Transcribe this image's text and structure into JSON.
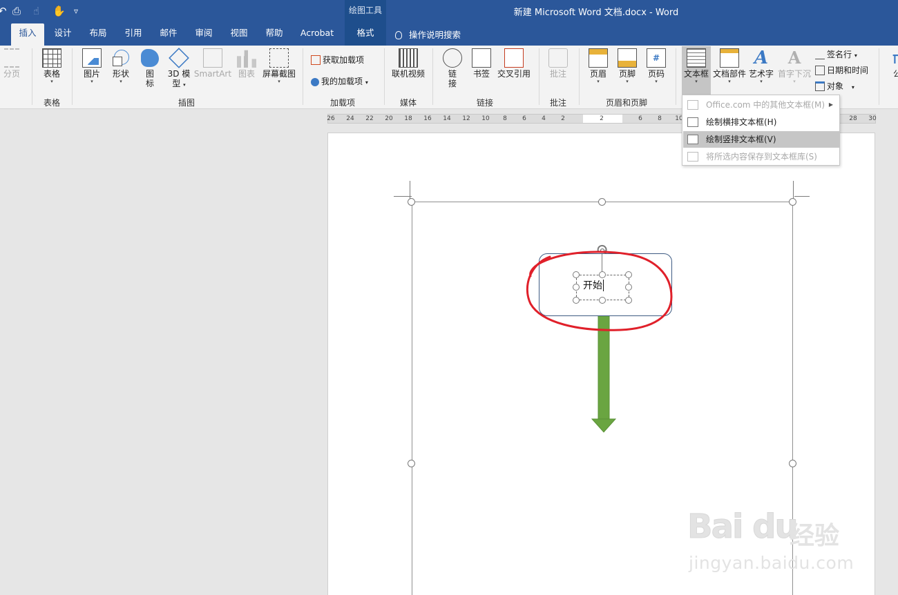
{
  "titlebar": {
    "doc_title": "新建 Microsoft Word 文档.docx  -  Word",
    "context_group": "绘图工具",
    "quick_access": {
      "undo": "↶",
      "print_preview": "⎙",
      "touch": "☝",
      "customize": "▿"
    }
  },
  "tabs": [
    {
      "label": "插入"
    },
    {
      "label": "设计"
    },
    {
      "label": "布局"
    },
    {
      "label": "引用"
    },
    {
      "label": "邮件"
    },
    {
      "label": "审阅"
    },
    {
      "label": "视图"
    },
    {
      "label": "帮助"
    },
    {
      "label": "Acrobat"
    },
    {
      "label": "格式"
    }
  ],
  "tell_me": "操作说明搜索",
  "ribbon": {
    "page_break": "分页",
    "table": "表格",
    "pictures": "图片",
    "shapes": "形状",
    "icons_line1": "图",
    "icons_line2": "标",
    "model3d_line1": "3D 模",
    "model3d_line2": "型",
    "smartart": "SmartArt",
    "chart": "图表",
    "screenshot": "屏幕截图",
    "get_addins": "获取加载项",
    "my_addins": "我的加载项",
    "online_video": "联机视频",
    "link_line1": "链",
    "link_line2": "接",
    "bookmark": "书签",
    "cross_ref": "交叉引用",
    "comment": "批注",
    "header": "页眉",
    "footer": "页脚",
    "page_number": "页码",
    "text_box": "文本框",
    "quick_parts": "文档部件",
    "wordart": "艺术字",
    "drop_cap": "首字下沉",
    "signature_line": "签名行",
    "date_time": "日期和时间",
    "object": "对象",
    "equation_partial": "公",
    "groups": {
      "tables": "表格",
      "illustrations": "插图",
      "addins": "加载项",
      "media": "媒体",
      "links": "链接",
      "comments": "批注",
      "header_footer": "页眉和页脚"
    }
  },
  "ruler_ticks": [
    "26",
    "24",
    "22",
    "20",
    "18",
    "16",
    "14",
    "12",
    "10",
    "8",
    "6",
    "4",
    "2",
    "2",
    "6",
    "8",
    "10",
    "28",
    "30"
  ],
  "textbox_menu": {
    "items": [
      {
        "label": "Office.com 中的其他文本框(M)",
        "disabled": true
      },
      {
        "label": "绘制横排文本框(H)",
        "disabled": false
      },
      {
        "label": "绘制竖排文本框(V)",
        "disabled": false
      },
      {
        "label": "将所选内容保存到文本框库(S)",
        "disabled": true
      }
    ]
  },
  "document": {
    "shape_text": "开始",
    "arrow_color": "#6aa541",
    "annotation_color": "#e0202a"
  },
  "watermark": {
    "logo": "Bai du",
    "cn": "经验",
    "url": "jingyan.baidu.com"
  },
  "colors": {
    "word_blue": "#2b579a",
    "context_blue": "#1e4e8c",
    "menu_highlight": "#c6c6c6"
  }
}
